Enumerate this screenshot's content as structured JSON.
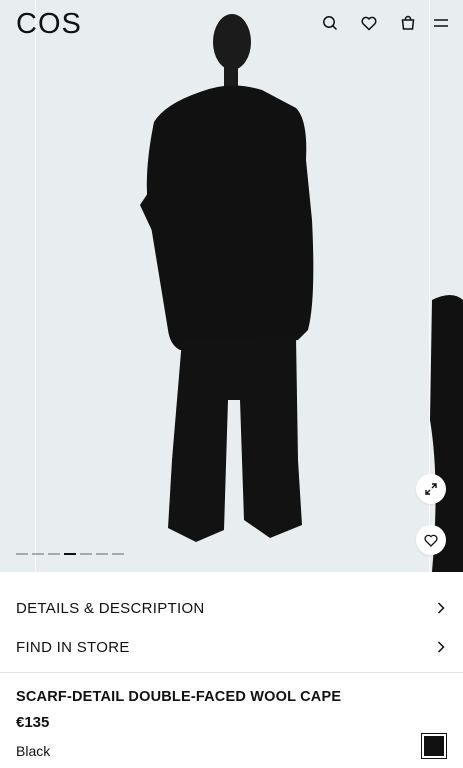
{
  "header": {
    "logo": "COS",
    "icons": [
      "search-icon",
      "heart-icon",
      "bag-icon",
      "menu-icon"
    ]
  },
  "gallery": {
    "image_count": 7,
    "active_index": 3,
    "expand_icon": "expand-icon",
    "wishlist_icon": "heart-icon"
  },
  "accordion": {
    "details_label": "DETAILS & DESCRIPTION",
    "store_label": "FIND IN STORE"
  },
  "product": {
    "name": "SCARF-DETAIL DOUBLE-FACED WOOL CAPE",
    "price": "€135",
    "color": "Black",
    "swatch_color": "#111111"
  }
}
